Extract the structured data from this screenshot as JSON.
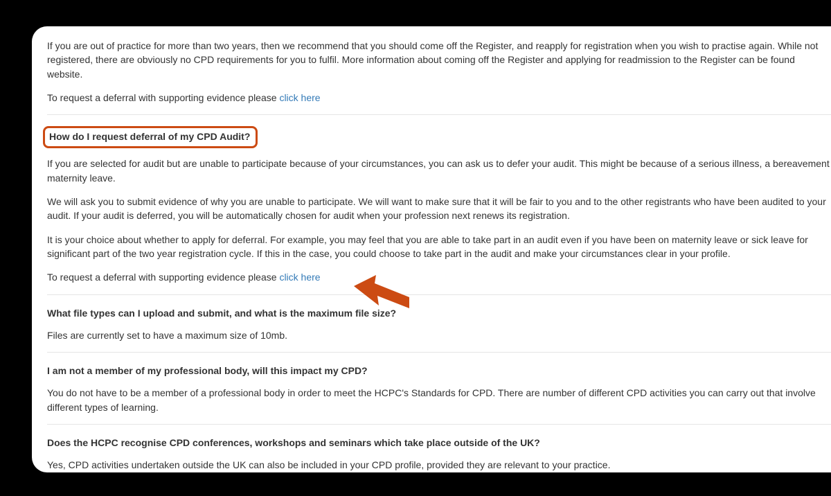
{
  "sec0": {
    "p1": "If you are out of practice for more than two years, then we recommend that you should come off the Register, and reapply for registration when you wish to practise again. While not registered, there are obviously no CPD requirements for you to fulfil. More information about coming off the Register and applying for readmission to the Register can be found website.",
    "p2_prefix": "To request a deferral with supporting evidence please ",
    "p2_link": "click here"
  },
  "sec1": {
    "q": "How do I request deferral of my CPD Audit?",
    "p1": "If you are selected for audit but are unable to participate because of your circumstances, you can ask us to defer your audit. This might be because of a serious illness, a bereavement maternity leave.",
    "p2": "We will ask you to submit evidence of why you are unable to participate. We will want to make sure that it will be fair to you and to the other registrants who have been audited to your audit. If your audit is deferred, you will be automatically chosen for audit when your profession next renews its registration.",
    "p3": "It is your choice about whether to apply for deferral. For example, you may feel that you are able to take part in an audit even if you have been on maternity leave or sick leave for significant part of the two year registration cycle. If this in the case, you could choose to take part in the audit and make your circumstances clear in your profile.",
    "p4_prefix": "To request a deferral with supporting evidence please ",
    "p4_link": "click here"
  },
  "sec2": {
    "q": "What file types can I upload and submit, and what is the maximum file size?",
    "p1": "Files are currently set to have a maximum size of 10mb."
  },
  "sec3": {
    "q": "I am not a member of my professional body, will this impact my CPD?",
    "p1": "You do not have to be a member of a professional body in order to meet the HCPC's Standards for CPD. There are number of different CPD activities you can carry out that involve different types of learning."
  },
  "sec4": {
    "q": "Does the HCPC recognise CPD conferences, workshops and seminars which take place outside of the UK?",
    "p1": "Yes, CPD activities undertaken outside the UK can also be included in your CPD profile, provided they are relevant to your practice."
  },
  "annotation": {
    "highlight_color": "#cc4b13",
    "arrow_color": "#cc4b13"
  }
}
